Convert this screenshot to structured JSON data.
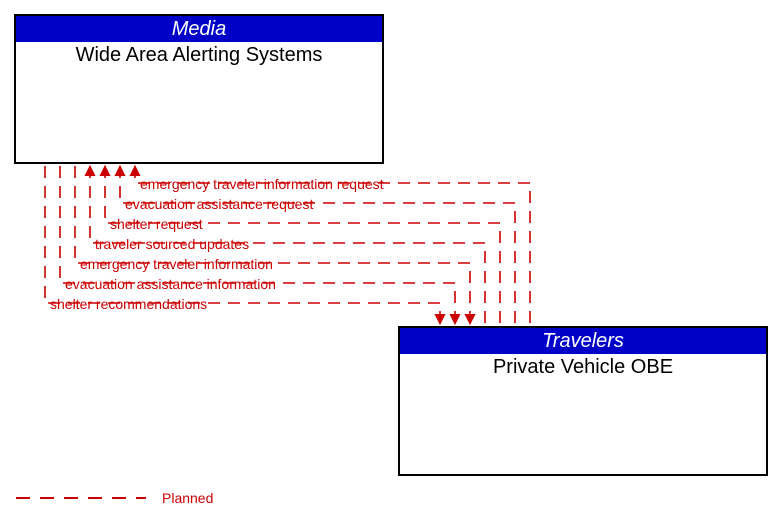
{
  "boxes": {
    "media": {
      "header": "Media",
      "title": "Wide Area Alerting Systems"
    },
    "travelers": {
      "header": "Travelers",
      "title": "Private Vehicle OBE"
    }
  },
  "flows": [
    {
      "label": "emergency traveler information request",
      "direction": "to_media"
    },
    {
      "label": "evacuation assistance request",
      "direction": "to_media"
    },
    {
      "label": "shelter request",
      "direction": "to_media"
    },
    {
      "label": "traveler sourced updates",
      "direction": "to_media"
    },
    {
      "label": "emergency traveler information",
      "direction": "to_travelers"
    },
    {
      "label": "evacuation assistance information",
      "direction": "to_travelers"
    },
    {
      "label": "shelter recommendations",
      "direction": "to_travelers"
    }
  ],
  "legend": {
    "planned": "Planned"
  },
  "style": {
    "flow_color": "#cc0000",
    "header_color": "#0000c8",
    "line_style": "dashed"
  }
}
